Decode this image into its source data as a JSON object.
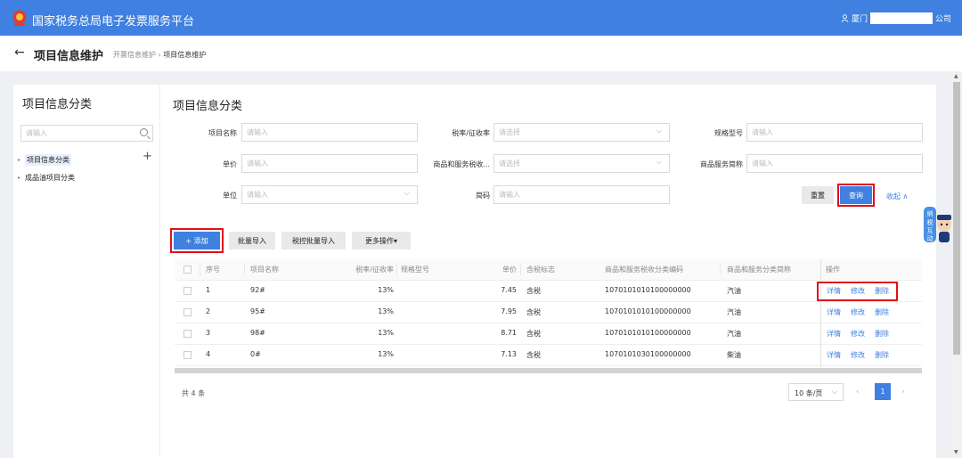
{
  "header": {
    "app_title": "国家税务总局电子发票服务平台",
    "user_prefix": "厦门",
    "user_suffix": "公司"
  },
  "breadcrumb": {
    "back_icon": "arrow-left-icon",
    "page_title": "项目信息维护",
    "parent": "开票信息维护",
    "separator": "›",
    "current": "项目信息维护"
  },
  "sidebar": {
    "title": "项目信息分类",
    "search_placeholder": "请输入",
    "items": [
      {
        "label": "项目信息分类",
        "selected": true
      },
      {
        "label": "成品油项目分类",
        "selected": false
      }
    ],
    "add_icon": "+"
  },
  "main": {
    "title": "项目信息分类"
  },
  "filters": {
    "item_name": {
      "label": "项目名称",
      "placeholder": "请输入"
    },
    "tax_rate": {
      "label": "税率/征收率",
      "placeholder": "请选择"
    },
    "spec": {
      "label": "规格型号",
      "placeholder": "请输入"
    },
    "unit_price": {
      "label": "单价",
      "placeholder": "请输入"
    },
    "tax_category": {
      "label": "商品和服务税收...",
      "placeholder": "请选择"
    },
    "short_name": {
      "label": "商品服务简称",
      "placeholder": "请输入"
    },
    "unit": {
      "label": "单位",
      "placeholder": "请输入"
    },
    "abbr": {
      "label": "简码",
      "placeholder": "请输入"
    }
  },
  "actions": {
    "reset": "重置",
    "search": "查询",
    "collapse": "收起 ∧",
    "add": "+ 添加",
    "batch_import": "批量导入",
    "tax_batch_import": "税控批量导入",
    "more": "更多操作▾"
  },
  "table": {
    "headers": [
      "序号",
      "项目名称",
      "税率/征收率",
      "规格型号",
      "单价",
      "含税标志",
      "商品和服务税收分类编码",
      "商品和服务分类简称",
      "操作"
    ],
    "rows": [
      {
        "no": "1",
        "name": "92#",
        "rate": "13%",
        "spec": "",
        "price": "7.45",
        "tax_flag": "含税",
        "code": "1070101010100000000",
        "category": "汽油"
      },
      {
        "no": "2",
        "name": "95#",
        "rate": "13%",
        "spec": "",
        "price": "7.95",
        "tax_flag": "含税",
        "code": "1070101010100000000",
        "category": "汽油"
      },
      {
        "no": "3",
        "name": "98#",
        "rate": "13%",
        "spec": "",
        "price": "8.71",
        "tax_flag": "含税",
        "code": "1070101010100000000",
        "category": "汽油"
      },
      {
        "no": "4",
        "name": "0#",
        "rate": "13%",
        "spec": "",
        "price": "7.13",
        "tax_flag": "含税",
        "code": "1070101030100000000",
        "category": "柴油"
      }
    ],
    "ops": {
      "detail": "详情",
      "edit": "修改",
      "delete": "删除"
    }
  },
  "pagination": {
    "total": "共 4 条",
    "page_size": "10 条/页",
    "page": "1",
    "prev": "‹",
    "next": "›"
  },
  "mascot_text": "纳税互动",
  "mascot_icon": "tax-interaction-mascot-icon"
}
